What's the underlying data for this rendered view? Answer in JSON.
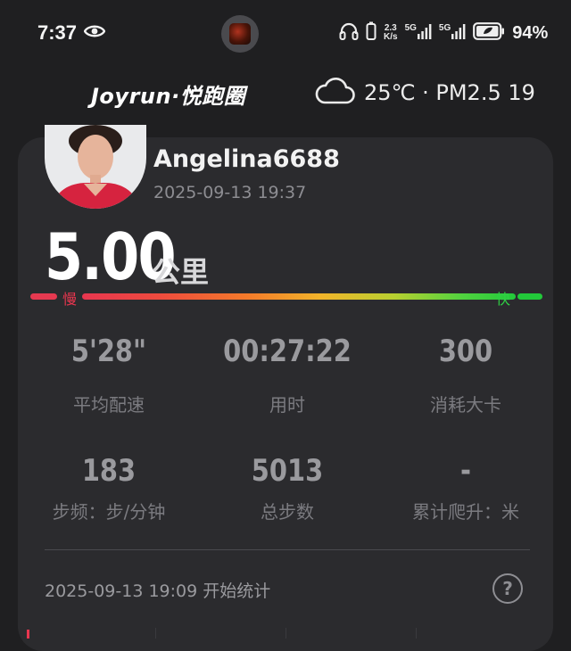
{
  "status_bar": {
    "time": "7:37",
    "speed_top": "2.3",
    "speed_bottom": "K/s",
    "net1": "5G",
    "net2": "5G",
    "battery": "94%"
  },
  "header": {
    "brand": "Joyrun·悦跑圈",
    "weather_icon": "cloud-icon",
    "weather_text": "25℃ · PM2.5 19"
  },
  "run": {
    "username": "Angelina6688",
    "time": "2025-09-13 19:37",
    "distance": "5.00",
    "distance_unit": "公里",
    "slow_label": "慢",
    "fast_label": "快",
    "stats": [
      {
        "value": "5'28\"",
        "label": "平均配速"
      },
      {
        "value": "00:27:22",
        "label": "用时"
      },
      {
        "value": "300",
        "label": "消耗大卡"
      },
      {
        "value": "183",
        "label": "步频：步/分钟"
      },
      {
        "value": "5013",
        "label": "总步数"
      },
      {
        "value": "-",
        "label": "累计爬升：米"
      }
    ],
    "start_stat": "2025-09-13 19:09  开始统计",
    "help": "?"
  },
  "colors": {
    "background": "#1f1f21",
    "card": "#2b2b2e",
    "slow": "#e8364f",
    "fast": "#22c93a"
  }
}
